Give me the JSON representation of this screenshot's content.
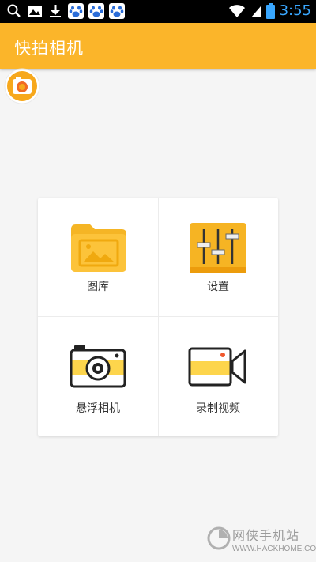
{
  "status_bar": {
    "time": "3:55",
    "left_icons": [
      "search-icon",
      "image-icon",
      "download-icon",
      "baidu-paw-icon",
      "baidu-paw-icon",
      "baidu-paw-icon"
    ],
    "right_icons": [
      "wifi-icon",
      "signal-icon",
      "battery-icon"
    ]
  },
  "app_bar": {
    "title": "快拍相机",
    "color": "#fbb52a"
  },
  "menu": {
    "items": [
      {
        "label": "图库",
        "icon": "gallery-folder-icon"
      },
      {
        "label": "设置",
        "icon": "settings-sliders-icon"
      },
      {
        "label": "悬浮相机",
        "icon": "camera-icon"
      },
      {
        "label": "录制视频",
        "icon": "video-camera-icon"
      }
    ]
  },
  "watermark": {
    "text": "网侠手机站",
    "url": "WWW.HACKHOME.COM"
  },
  "colors": {
    "accent": "#fbb52a",
    "status_bar": "#000000",
    "clock": "#39a7ff"
  }
}
